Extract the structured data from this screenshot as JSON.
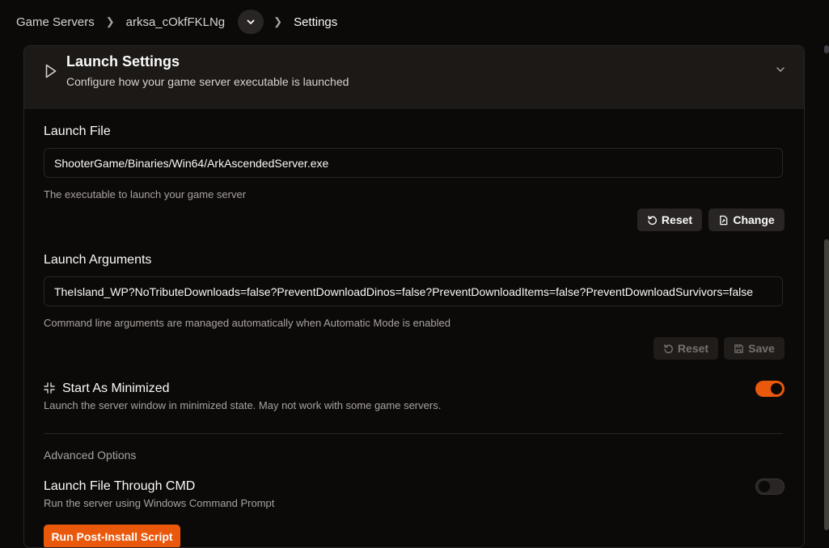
{
  "breadcrumb": {
    "items": [
      "Game Servers",
      "arksa_cOkfFKLNg",
      "Settings"
    ]
  },
  "section": {
    "title": "Launch Settings",
    "subtitle": "Configure how your game server executable is launched"
  },
  "launch_file": {
    "label": "Launch File",
    "value": "ShooterGame/Binaries/Win64/ArkAscendedServer.exe",
    "help": "The executable to launch your game server",
    "reset_label": "Reset",
    "change_label": "Change"
  },
  "launch_args": {
    "label": "Launch Arguments",
    "value": "TheIsland_WP?NoTributeDownloads=false?PreventDownloadDinos=false?PreventDownloadItems=false?PreventDownloadSurvivors=false",
    "help": "Command line arguments are managed automatically when Automatic Mode is enabled",
    "reset_label": "Reset",
    "save_label": "Save"
  },
  "start_minimized": {
    "label": "Start As Minimized",
    "help": "Launch the server window in minimized state. May not work with some game servers.",
    "enabled": true
  },
  "advanced": {
    "heading": "Advanced Options",
    "cmd": {
      "label": "Launch File Through CMD",
      "help": "Run the server using Windows Command Prompt",
      "enabled": false
    },
    "post_install_label": "Run Post-Install Script"
  },
  "colors": {
    "accent": "#ea580c",
    "background": "#0c0a09",
    "header_bg": "#1c1917"
  }
}
